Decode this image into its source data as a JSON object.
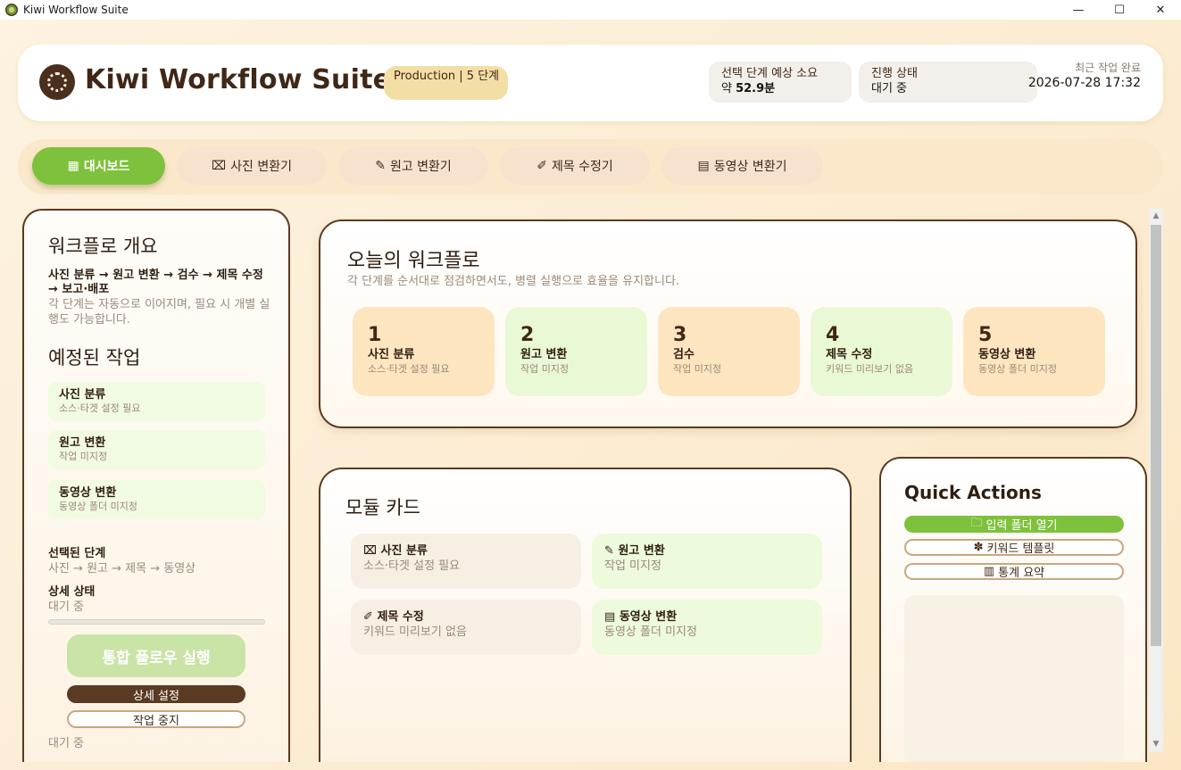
{
  "window": {
    "title": "Kiwi Workflow Suite",
    "controls": {
      "minimize": "—",
      "maximize": "☐",
      "close": "✕"
    }
  },
  "header": {
    "app_title": "Kiwi Workflow Suite",
    "env_badge": "Production | 5 단계",
    "time_label": "선택 단계 예상 소요",
    "time_prefix": "약 ",
    "time_value": "52.9분",
    "progress_label": "진행 상태",
    "progress_value": "대기 중",
    "last_done_label": "최근 작업 완료",
    "last_done_value": "2026-07-28 17:32"
  },
  "nav": {
    "tabs": [
      {
        "icon": "▦",
        "label": "대시보드"
      },
      {
        "icon": "⌧",
        "label": "사진 변환기"
      },
      {
        "icon": "✎",
        "label": "원고 변환기"
      },
      {
        "icon": "✐",
        "label": "제목 수정기"
      },
      {
        "icon": "▤",
        "label": "동영상 변환기"
      }
    ]
  },
  "left": {
    "overview_title": "워크플로 개요",
    "overview_flow": "사진 분류 → 원고 변환 → 검수 → 제목 수정 → 보고·배포",
    "overview_desc": "각 단계는 자동으로 이어지며, 필요 시 개별 실행도 가능합니다.",
    "scheduled_title": "예정된 작업",
    "scheduled": [
      {
        "title": "사진 분류",
        "sub": "소스·타겟 설정 필요"
      },
      {
        "title": "원고 변환",
        "sub": "작업 미지정"
      },
      {
        "title": "동영상 변환",
        "sub": "동영상 폴더 미지정"
      }
    ],
    "selected_label": "선택된 단계",
    "selected_value": "사진 → 원고 → 제목 → 동영상",
    "detail_label": "상세 상태",
    "detail_value": "대기 중",
    "progress": 0,
    "run_button": "통합 플로우 실행",
    "settings_button": "상세 설정",
    "stop_button": "작업 중지",
    "status_text": "대기 중"
  },
  "today": {
    "title": "오늘의 워크플로",
    "subtitle": "각 단계를 순서대로 점검하면서도, 병렬 실행으로 효율을 유지합니다.",
    "steps": [
      {
        "num": "1",
        "title": "사진 분류",
        "sub": "소스·타겟 설정 필요"
      },
      {
        "num": "2",
        "title": "원고 변환",
        "sub": "작업 미지정"
      },
      {
        "num": "3",
        "title": "검수",
        "sub": "작업 미지정"
      },
      {
        "num": "4",
        "title": "제목 수정",
        "sub": "키워드 미리보기 없음"
      },
      {
        "num": "5",
        "title": "동영상 변환",
        "sub": "동영상 폴더 미지정"
      }
    ]
  },
  "modules": {
    "title": "모듈 카드",
    "cards": [
      {
        "icon": "⌧",
        "title": "사진 분류",
        "sub": "소스·타겟 설정 필요"
      },
      {
        "icon": "✎",
        "title": "원고 변환",
        "sub": "작업 미지정"
      },
      {
        "icon": "✐",
        "title": "제목 수정",
        "sub": "키워드 미리보기 없음"
      },
      {
        "icon": "▤",
        "title": "동영상 변환",
        "sub": "동영상 폴더 미지정"
      }
    ]
  },
  "quick": {
    "title": "Quick Actions",
    "buttons": [
      {
        "icon": "🗀",
        "label": "입력 폴더 열기"
      },
      {
        "icon": "✽",
        "label": "키워드 템플릿"
      },
      {
        "icon": "▥",
        "label": "통계 요약"
      }
    ]
  },
  "colors": {
    "accent_green": "#7ec13c",
    "brown": "#5a3a22",
    "step_orange": "#fde5c0",
    "step_green": "#e9f8d5"
  }
}
